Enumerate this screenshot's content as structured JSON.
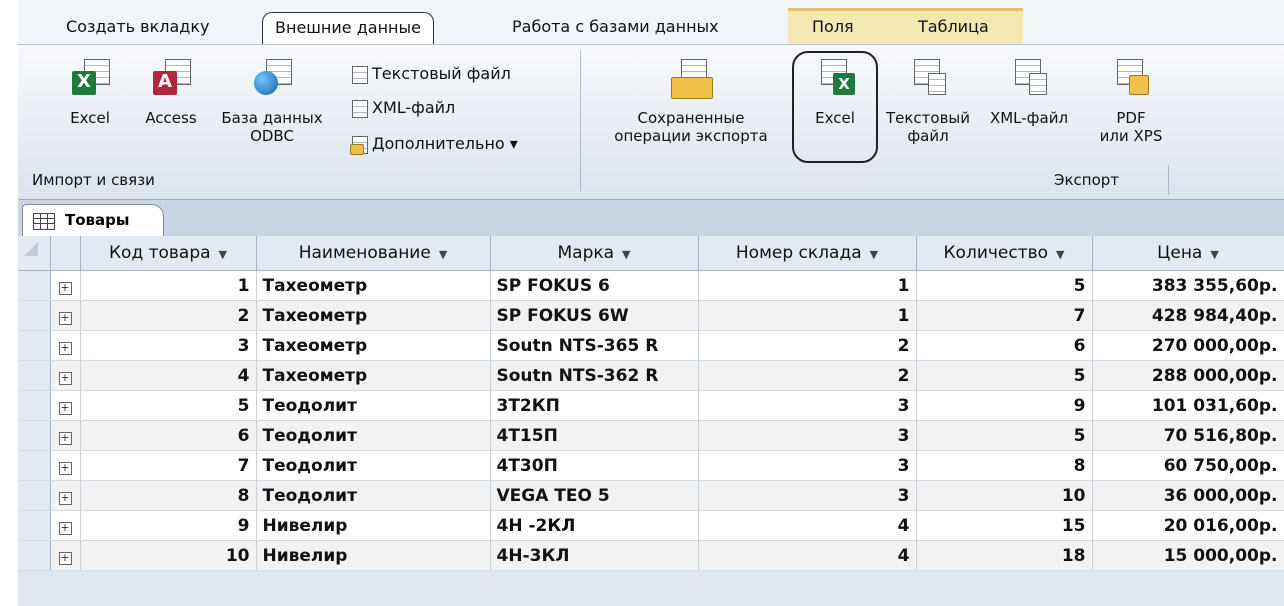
{
  "ribbon": {
    "tabs": [
      "Создать вкладку",
      "Внешние данные",
      "Работа с базами данных",
      "Поля",
      "Таблица"
    ],
    "import": {
      "excel": "Excel",
      "access": "Access",
      "odbc_line1": "База данных",
      "odbc_line2": "ODBC",
      "text_file": "Текстовый файл",
      "xml_file": "XML-файл",
      "more": "Дополнительно ▾",
      "group_label": "Импорт и связи"
    },
    "export": {
      "saved_line1": "Сохраненные",
      "saved_line2": "операции экспорта",
      "excel": "Excel",
      "text_line1": "Текстовый",
      "text_line2": "файл",
      "xml": "XML-файл",
      "pdf_line1": "PDF",
      "pdf_line2": "или XPS",
      "group_label": "Экспорт"
    }
  },
  "object_tab": "Товары",
  "table": {
    "columns": [
      "Код товара",
      "Наименование",
      "Марка",
      "Номер склада",
      "Количество",
      "Цена"
    ],
    "rows": [
      [
        "1",
        "Тахеометр",
        "SP FOKUS 6",
        "1",
        "5",
        "383 355,60р."
      ],
      [
        "2",
        "Тахеометр",
        "SP FOKUS 6W",
        "1",
        "7",
        "428 984,40р."
      ],
      [
        "3",
        "Тахеометр",
        "Soutn NTS-365 R",
        "2",
        "6",
        "270 000,00р."
      ],
      [
        "4",
        "Тахеометр",
        "Soutn NTS-362 R",
        "2",
        "5",
        "288 000,00р."
      ],
      [
        "5",
        "Теодолит",
        "3Т2КП",
        "3",
        "9",
        "101 031,60р."
      ],
      [
        "6",
        "Теодолит",
        "4Т15П",
        "3",
        "5",
        "70 516,80р."
      ],
      [
        "7",
        "Теодолит",
        "4Т30П",
        "3",
        "8",
        "60 750,00р."
      ],
      [
        "8",
        "Теодолит",
        "VEGA TEO 5",
        "3",
        "10",
        "36 000,00р."
      ],
      [
        "9",
        "Нивелир",
        "4Н -2КЛ",
        "4",
        "15",
        "20 016,00р."
      ],
      [
        "10",
        "Нивелир",
        "4Н-3КЛ",
        "4",
        "18",
        "15 000,00р."
      ]
    ]
  }
}
